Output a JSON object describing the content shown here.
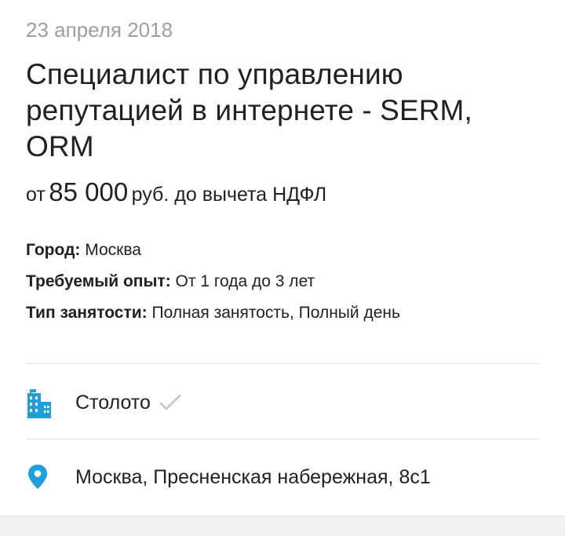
{
  "vacancy": {
    "date": "23 апреля 2018",
    "title": "Специалист по управлению репутацией в интернете - SERM, ORM",
    "salary": {
      "prefix": "от",
      "amount": "85 000",
      "suffix": "руб. до вычета НДФЛ"
    },
    "properties": [
      {
        "label": "Город:",
        "value": "Москва"
      },
      {
        "label": "Требуемый опыт:",
        "value": "От 1 года до 3 лет"
      },
      {
        "label": "Тип занятости:",
        "value": "Полная занятость, Полный день"
      }
    ],
    "company": {
      "name": "Столото",
      "icon": "building-icon",
      "verified_icon": "checkmark-icon"
    },
    "address": {
      "text": "Москва, Пресненская набережная, 8с1",
      "icon": "location-pin-icon"
    }
  },
  "colors": {
    "accent": "#1ea0dc",
    "text_primary": "#212121",
    "text_secondary": "#9e9e9e",
    "divider": "#e0e0e0",
    "check": "#c4c4c4"
  }
}
